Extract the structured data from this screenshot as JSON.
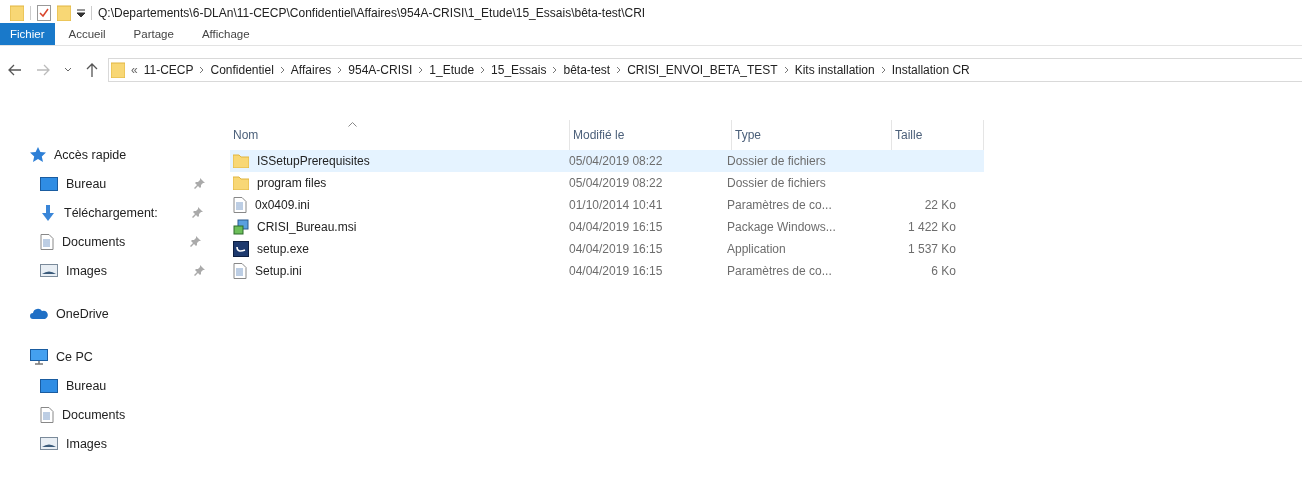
{
  "title_bar": {
    "path": "Q:\\Departements\\6-DLAn\\11-CECP\\Confidentiel\\Affaires\\954A-CRISI\\1_Etude\\15_Essais\\bêta-test\\CRI"
  },
  "ribbon_tabs": [
    {
      "label": "Fichier",
      "selected": true
    },
    {
      "label": "Accueil",
      "selected": false
    },
    {
      "label": "Partage",
      "selected": false
    },
    {
      "label": "Affichage",
      "selected": false
    }
  ],
  "address_bar": {
    "overflow": "«",
    "crumbs": [
      "11-CECP",
      "Confidentiel",
      "Affaires",
      "954A-CRISI",
      "1_Etude",
      "15_Essais",
      "bêta-test",
      "CRISI_ENVOI_BETA_TEST",
      "Kits installation",
      "Installation CR"
    ]
  },
  "sidebar": [
    {
      "label": "Accès rapide",
      "kind": "star",
      "children": [
        {
          "label": "Bureau",
          "kind": "desktop",
          "pinned": true
        },
        {
          "label": "Téléchargement:",
          "kind": "download",
          "pinned": true
        },
        {
          "label": "Documents",
          "kind": "documents",
          "pinned": true
        },
        {
          "label": "Images",
          "kind": "pictures",
          "pinned": true
        }
      ]
    },
    {
      "label": "OneDrive",
      "kind": "cloud"
    },
    {
      "label": "Ce PC",
      "kind": "pc",
      "children": [
        {
          "label": "Bureau",
          "kind": "desktop",
          "pinned": false
        },
        {
          "label": "Documents",
          "kind": "documents",
          "pinned": false
        },
        {
          "label": "Images",
          "kind": "pictures",
          "pinned": false
        }
      ]
    }
  ],
  "table": {
    "columns": [
      {
        "label": "Nom",
        "sorted": true
      },
      {
        "label": "Modifié le",
        "sorted": false
      },
      {
        "label": "Type",
        "sorted": false
      },
      {
        "label": "Taille",
        "sorted": false
      }
    ],
    "rows": [
      {
        "kind": "folder",
        "name": "ISSetupPrerequisites",
        "modified": "05/04/2019 08:22",
        "type": "Dossier de fichiers",
        "size": "",
        "selected": true
      },
      {
        "kind": "folder",
        "name": "program files",
        "modified": "05/04/2019 08:22",
        "type": "Dossier de fichiers",
        "size": "",
        "selected": false
      },
      {
        "kind": "ini",
        "name": "0x0409.ini",
        "modified": "01/10/2014 10:41",
        "type": "Paramètres de co...",
        "size": "22 Ko",
        "selected": false
      },
      {
        "kind": "msi",
        "name": "CRISI_Bureau.msi",
        "modified": "04/04/2019 16:15",
        "type": "Package Windows...",
        "size": "1 422 Ko",
        "selected": false
      },
      {
        "kind": "exe",
        "name": "setup.exe",
        "modified": "04/04/2019 16:15",
        "type": "Application",
        "size": "1 537 Ko",
        "selected": false
      },
      {
        "kind": "ini",
        "name": "Setup.ini",
        "modified": "04/04/2019 16:15",
        "type": "Paramètres de co...",
        "size": "6 Ko",
        "selected": false
      }
    ]
  }
}
